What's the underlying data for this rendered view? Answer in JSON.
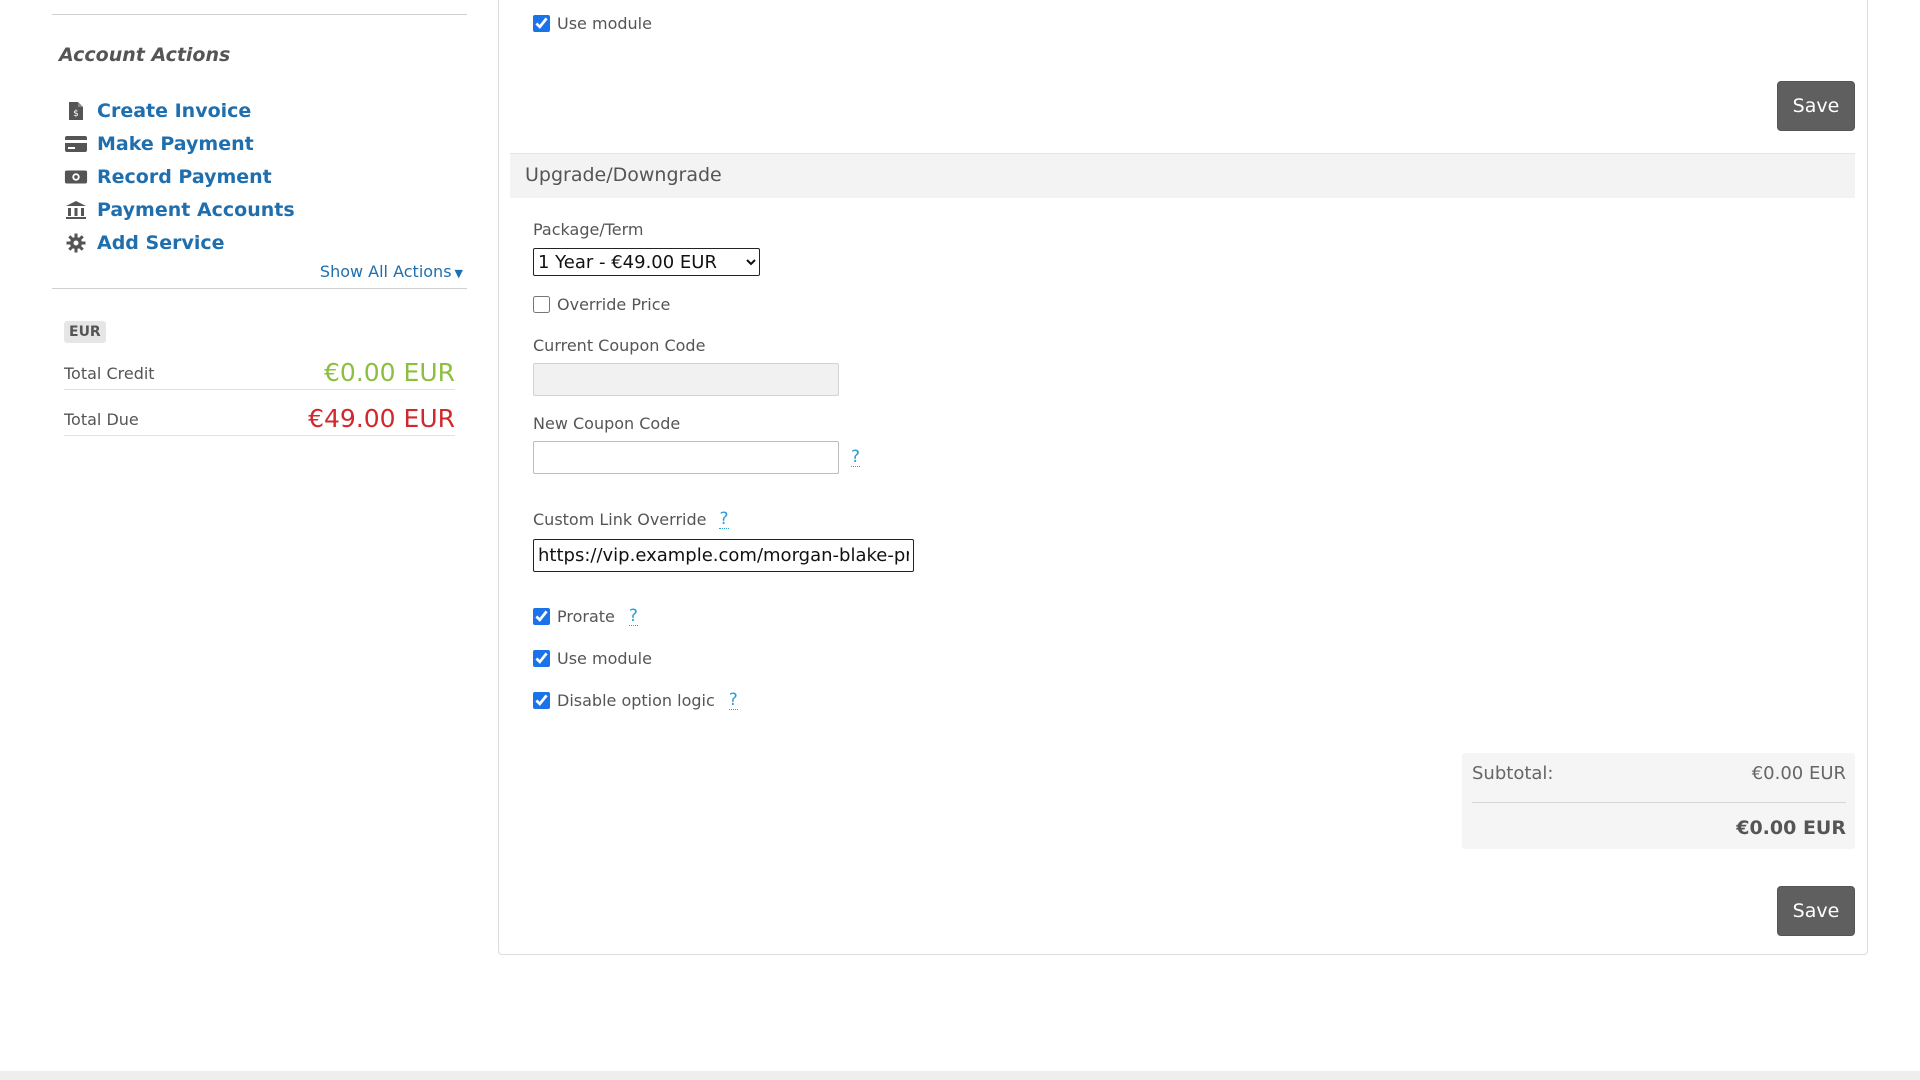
{
  "sidebar": {
    "title": "Account Actions",
    "actions": [
      {
        "label": "Create Invoice",
        "icon": "file-invoice-icon"
      },
      {
        "label": "Make Payment",
        "icon": "credit-card-icon"
      },
      {
        "label": "Record Payment",
        "icon": "money-bill-icon"
      },
      {
        "label": "Payment Accounts",
        "icon": "bank-icon"
      },
      {
        "label": "Add Service",
        "icon": "gear-icon"
      }
    ],
    "show_all": "Show All Actions",
    "currency": "EUR",
    "total_credit_label": "Total Credit",
    "total_credit_value": "€0.00 EUR",
    "total_due_label": "Total Due",
    "total_due_value": "€49.00 EUR"
  },
  "top": {
    "use_module_label": "Use module",
    "use_module_checked": true,
    "save_label": "Save"
  },
  "upgrade": {
    "section_title": "Upgrade/Downgrade",
    "package_label": "Package/Term",
    "package_selected": "1 Year - €49.00 EUR",
    "override_price_label": "Override Price",
    "override_price_checked": false,
    "current_coupon_label": "Current Coupon Code",
    "current_coupon_value": "",
    "new_coupon_label": "New Coupon Code",
    "new_coupon_value": "",
    "help_glyph": "?",
    "custom_link_label": "Custom Link Override",
    "custom_link_value": "https://vip.example.com/morgan-blake-pr",
    "prorate_label": "Prorate",
    "prorate_checked": true,
    "use_module_label": "Use module",
    "use_module_checked": true,
    "disable_option_logic_label": "Disable option logic",
    "disable_option_logic_checked": true
  },
  "totals": {
    "subtotal_label": "Subtotal:",
    "subtotal_value": "€0.00 EUR",
    "total_value": "€0.00 EUR"
  },
  "bottom": {
    "save_label": "Save"
  },
  "colors": {
    "link": "#1f6fae",
    "credit_green": "#8cbf3f",
    "due_red": "#d1282d",
    "button_gray": "#5f5f5f",
    "help_blue": "#2a9fd6"
  }
}
